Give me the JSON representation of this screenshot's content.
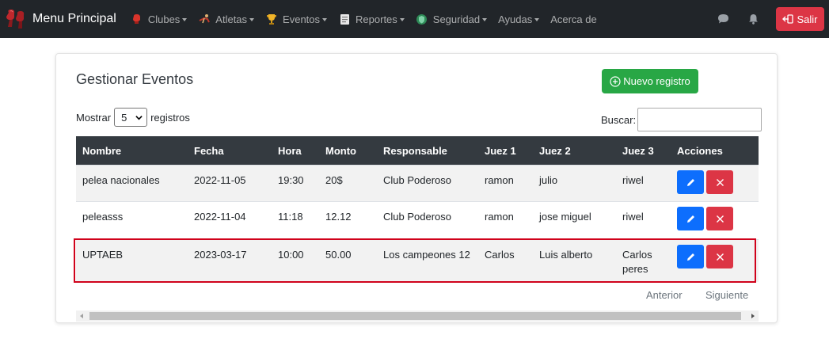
{
  "navbar": {
    "brand": "Menu Principal",
    "items": [
      {
        "label": "Clubes",
        "icon": "boxing-glove-icon"
      },
      {
        "label": "Atletas",
        "icon": "athlete-icon"
      },
      {
        "label": "Eventos",
        "icon": "trophy-icon"
      },
      {
        "label": "Reportes",
        "icon": "report-icon"
      },
      {
        "label": "Seguridad",
        "icon": "shield-icon"
      },
      {
        "label": "Ayudas",
        "icon": ""
      },
      {
        "label": "Acerca de",
        "icon": ""
      }
    ],
    "logout_label": "Salir",
    "colors": {
      "navbar_bg": "#212529",
      "logout_bg": "#dc3545"
    }
  },
  "page": {
    "title": "Gestionar Eventos",
    "new_button": "Nuevo registro",
    "show_label": "Mostrar",
    "show_value": "5",
    "records_label": "registros",
    "search_label": "Buscar:",
    "search_value": ""
  },
  "table": {
    "columns": [
      "Nombre",
      "Fecha",
      "Hora",
      "Monto",
      "Responsable",
      "Juez 1",
      "Juez 2",
      "Juez 3",
      "Acciones"
    ],
    "rows": [
      {
        "nombre": "pelea nacionales",
        "fecha": "2022-11-05",
        "hora": "19:30",
        "monto": "20$",
        "responsable": "Club Poderoso",
        "juez1": "ramon",
        "juez2": "julio",
        "juez3": "riwel"
      },
      {
        "nombre": "peleasss",
        "fecha": "2022-11-04",
        "hora": "11:18",
        "monto": "12.12",
        "responsable": "Club Poderoso",
        "juez1": "ramon",
        "juez2": "jose miguel",
        "juez3": "riwel"
      },
      {
        "nombre": "UPTAEB",
        "fecha": "2023-03-17",
        "hora": "10:00",
        "monto": "50.00",
        "responsable": "Los campeones 12",
        "juez1": "Carlos",
        "juez2": "Luis alberto",
        "juez3": "Carlos peres"
      }
    ],
    "colors": {
      "header_bg": "#343a40",
      "edit_btn": "#0d6efd",
      "delete_btn": "#dc3545",
      "highlight": "#d0021b"
    }
  },
  "pagination": {
    "prev": "Anterior",
    "next": "Siguiente"
  }
}
